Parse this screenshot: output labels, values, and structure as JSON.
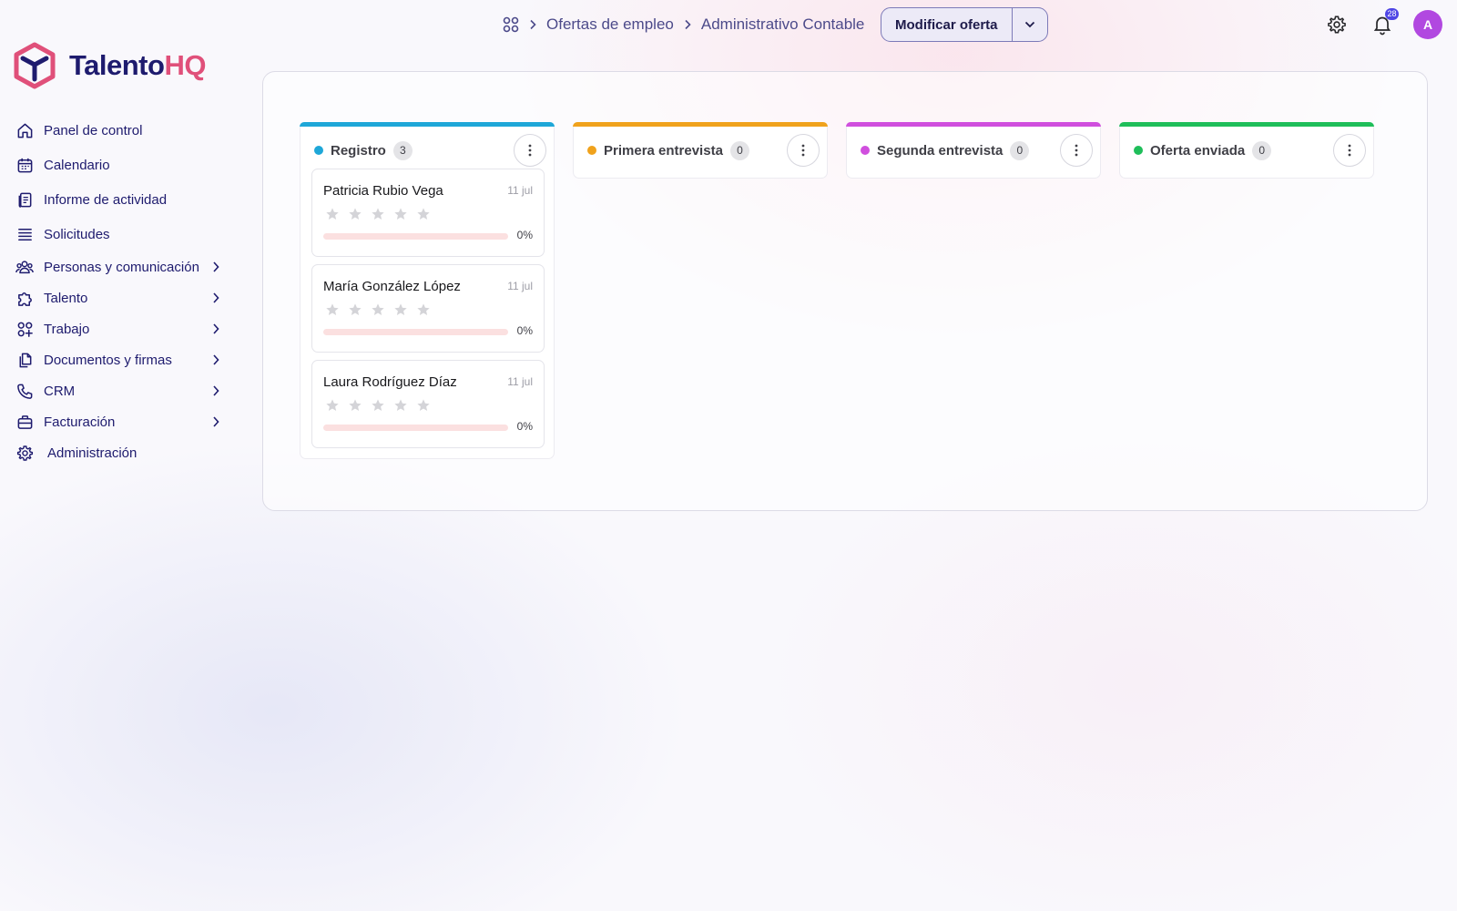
{
  "breadcrumb": {
    "items": [
      "Ofertas de empleo",
      "Administrativo Contable"
    ]
  },
  "actions": {
    "edit_label": "Modificar oferta"
  },
  "header": {
    "notifications_count": "28",
    "avatar_initial": "A"
  },
  "brand": {
    "name_part1": "Talento",
    "name_part2": "HQ",
    "color_primary": "#1e1b6e",
    "color_accent": "#e0507a"
  },
  "sidebar": {
    "items": [
      {
        "label": "Panel de control",
        "icon": "home-icon"
      },
      {
        "label": "Calendario",
        "icon": "calendar-icon"
      },
      {
        "label": "Informe de actividad",
        "icon": "report-icon"
      },
      {
        "label": "Solicitudes",
        "icon": "list-icon"
      },
      {
        "label": "Personas y comunicación",
        "icon": "people-icon"
      },
      {
        "label": "Talento",
        "icon": "puzzle-icon"
      },
      {
        "label": "Trabajo",
        "icon": "grid-plus-icon"
      },
      {
        "label": "Documentos y firmas",
        "icon": "documents-icon"
      },
      {
        "label": "CRM",
        "icon": "phone-icon"
      },
      {
        "label": "Facturación",
        "icon": "briefcase-icon"
      },
      {
        "label": "Administración",
        "icon": "gear-icon"
      }
    ]
  },
  "board": {
    "columns": [
      {
        "title": "Registro",
        "count": "3",
        "color": "#1ea7d8",
        "cards": [
          {
            "name": "Patricia Rubio Vega",
            "date": "11 jul",
            "rating": 0,
            "progress_text": "0%",
            "progress": 0
          },
          {
            "name": "María González López",
            "date": "11 jul",
            "rating": 0,
            "progress_text": "0%",
            "progress": 0
          },
          {
            "name": "Laura Rodríguez Díaz",
            "date": "11 jul",
            "rating": 0,
            "progress_text": "0%",
            "progress": 0
          }
        ]
      },
      {
        "title": "Primera entrevista",
        "count": "0",
        "color": "#f0a21c",
        "cards": []
      },
      {
        "title": "Segunda entrevista",
        "count": "0",
        "color": "#d04fde",
        "cards": []
      },
      {
        "title": "Oferta enviada",
        "count": "0",
        "color": "#1fbe5a",
        "cards": []
      }
    ]
  }
}
